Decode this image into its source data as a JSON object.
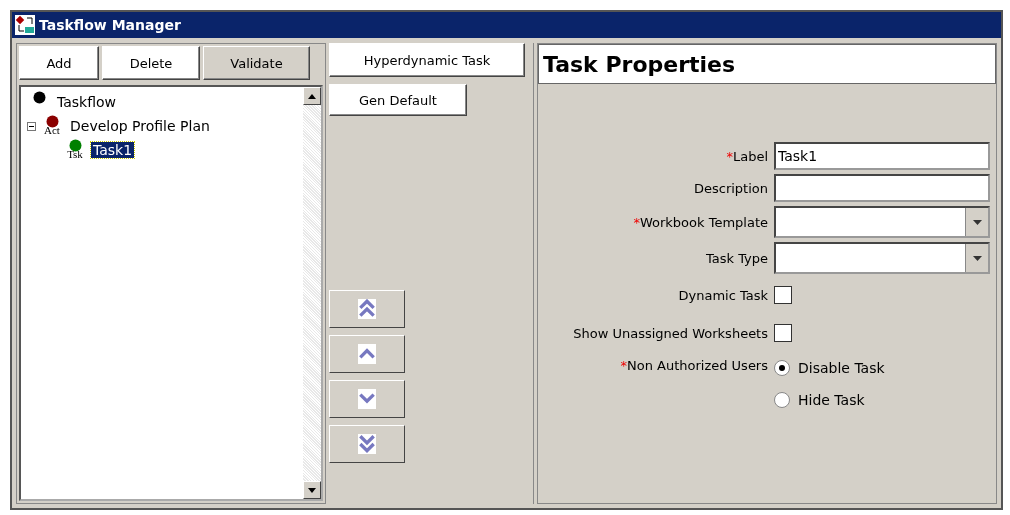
{
  "window": {
    "title": "Taskflow Manager"
  },
  "toolbar": [
    {
      "label": "Add",
      "kind": "light"
    },
    {
      "label": "Delete",
      "kind": "light"
    },
    {
      "label": "Validate",
      "kind": "grey"
    }
  ],
  "tree": [
    {
      "label": "Taskflow",
      "color": "#000000",
      "selected": false
    },
    {
      "label": "Develop Profile Plan",
      "badge": "Act",
      "color": "#8b0000",
      "selected": false,
      "expanded": true,
      "children": [
        {
          "label": "Task1",
          "badge": "Tsk",
          "color": "#008000",
          "selected": true
        }
      ]
    }
  ],
  "middle_buttons": [
    "Hyperdynamic Task",
    "Gen Default"
  ],
  "move_buttons": [
    {
      "kind": "top"
    },
    {
      "kind": "up"
    },
    {
      "kind": "down"
    },
    {
      "kind": "bottom"
    }
  ],
  "properties": {
    "title": "Task Properties",
    "fields": [
      {
        "kind": "text",
        "label": "Label",
        "required_mark": "*",
        "value": "Task1"
      },
      {
        "kind": "text",
        "label": "Description"
      },
      {
        "kind": "dropdown",
        "label": "Workbook Template",
        "required_mark": "*"
      },
      {
        "kind": "dropdown",
        "label": "Task Type"
      },
      {
        "kind": "checkbox",
        "label": "Dynamic Task",
        "checked": false
      },
      {
        "kind": "checkbox",
        "label": "Show Unassigned Worksheets",
        "checked": false
      },
      {
        "kind": "radio",
        "label": "Non Authorized Users",
        "required_mark": "*",
        "options": [
          {
            "label": "Disable Task",
            "selected": true
          },
          {
            "label": "Hide Task",
            "selected": false
          }
        ]
      }
    ]
  }
}
